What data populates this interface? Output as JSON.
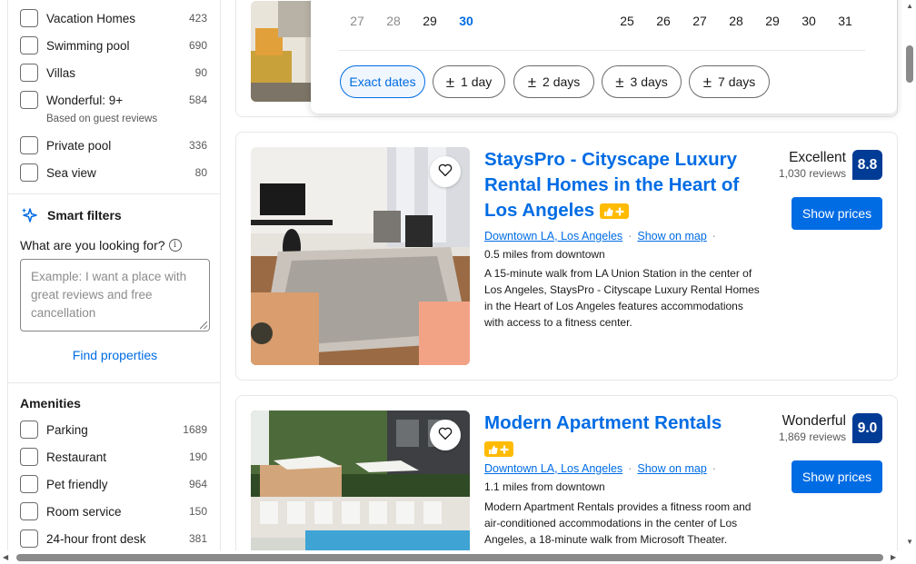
{
  "filters_top": [
    {
      "label": "Vacation Homes",
      "count": "423"
    },
    {
      "label": "Swimming pool",
      "count": "690"
    },
    {
      "label": "Villas",
      "count": "90"
    },
    {
      "label": "Wonderful: 9+",
      "count": "584",
      "sub": "Based on guest reviews"
    },
    {
      "label": "Private pool",
      "count": "336"
    },
    {
      "label": "Sea view",
      "count": "80"
    }
  ],
  "smart_filters": {
    "title": "Smart filters",
    "question": "What are you looking for?",
    "placeholder": "Example: I want a place with great reviews and free cancellation",
    "find_button": "Find properties"
  },
  "amenities": {
    "title": "Amenities",
    "items": [
      {
        "label": "Parking",
        "count": "1689"
      },
      {
        "label": "Restaurant",
        "count": "190"
      },
      {
        "label": "Pet friendly",
        "count": "964"
      },
      {
        "label": "Room service",
        "count": "150"
      },
      {
        "label": "24-hour front desk",
        "count": "381"
      }
    ]
  },
  "date_popup": {
    "left_days": [
      {
        "day": "27",
        "state": "past"
      },
      {
        "day": "28",
        "state": "past"
      },
      {
        "day": "29",
        "state": "normal"
      },
      {
        "day": "30",
        "state": "selected"
      }
    ],
    "right_days": [
      "25",
      "26",
      "27",
      "28",
      "29",
      "30",
      "31"
    ],
    "chips": [
      {
        "label": "Exact dates",
        "active": true,
        "plusminus": false
      },
      {
        "label": "1 day",
        "active": false,
        "plusminus": true
      },
      {
        "label": "2 days",
        "active": false,
        "plusminus": true
      },
      {
        "label": "3 days",
        "active": false,
        "plusminus": true
      },
      {
        "label": "7 days",
        "active": false,
        "plusminus": true
      }
    ],
    "plusminus_symbol": "±"
  },
  "results": [
    {
      "title": "StaysPro - Cityscape Luxury Rental Homes in the Heart of Los Angeles",
      "area": "Downtown LA, Los Angeles",
      "map_link": "Show on map",
      "distance": "0.5 miles from downtown",
      "description": "A 15-minute walk from LA Union Station in the center of Los Angeles, StaysPro - Cityscape Luxury Rental Homes in the Heart of Los Angeles features accommodations with access to a fitness center.",
      "rating_word": "Excellent",
      "reviews": "1,030 reviews",
      "score": "8.8",
      "button": "Show prices"
    },
    {
      "title": "Modern Apartment Rentals",
      "area": "Downtown LA, Los Angeles",
      "map_link": "Show on map",
      "distance": "1.1 miles from downtown",
      "description": "Modern Apartment Rentals provides a fitness room and air-conditioned accommodations in the center of Los Angeles, a 18-minute walk from Microsoft Theater.",
      "rating_word": "Wonderful",
      "reviews": "1,869 reviews",
      "score": "9.0",
      "button": "Show prices"
    }
  ],
  "colors": {
    "accent": "#006ce4",
    "score_bg": "#003b95",
    "genius_yellow": "#febb02"
  }
}
